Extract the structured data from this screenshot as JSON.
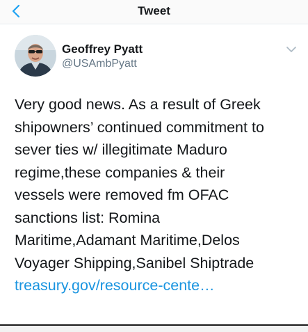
{
  "navbar": {
    "title": "Tweet",
    "back_icon": "chevron-left-icon",
    "accent_color": "#1da1f2"
  },
  "author": {
    "display_name": "Geoffrey Pyatt",
    "handle": "@USAmbPyatt",
    "avatar_icon": "profile-photo",
    "menu_icon": "chevron-down-icon"
  },
  "tweet": {
    "lines": [
      "Very good news. As a result of Greek",
      "shipowners’ continued commitment to",
      "sever ties w/ illegitimate Maduro",
      "regime,these companies & their",
      "vessels were removed fm OFAC",
      "sanctions list: Romina",
      "Maritime,Adamant Maritime,Delos",
      "Voyager Shipping,Sanibel Shiptrade"
    ],
    "link_text": "treasury.gov/resource-cente…",
    "link_color": "#1b95e0"
  }
}
